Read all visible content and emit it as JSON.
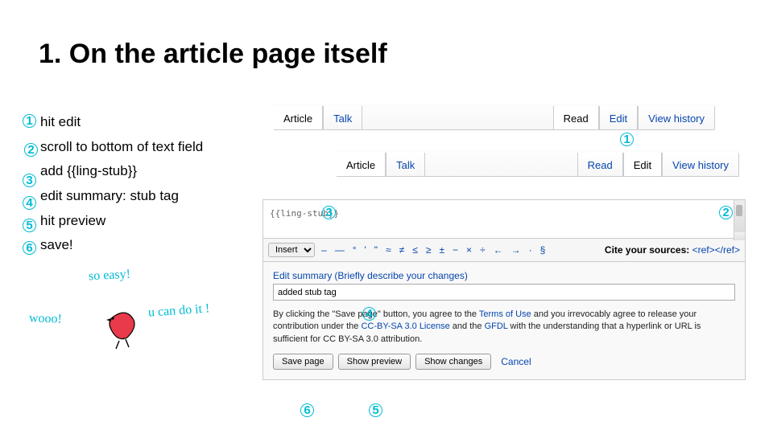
{
  "title": "1. On the article page itself",
  "steps": [
    "hit edit",
    "scroll to bottom of text field",
    "add {{ling-stub}}",
    "edit summary: stub tag",
    "hit preview",
    "save!"
  ],
  "tabs_top": {
    "article": "Article",
    "talk": "Talk",
    "read": "Read",
    "edit": "Edit",
    "history": "View history"
  },
  "tabs_mid": {
    "article": "Article",
    "talk": "Talk",
    "read": "Read",
    "edit": "Edit",
    "history": "View history"
  },
  "editor": {
    "textarea_value": "{{ling-stub}}",
    "insert_label": "Insert",
    "chars": [
      "–",
      "—",
      "°",
      "'",
      "\"",
      "≈",
      "≠",
      "≤",
      "≥",
      "±",
      "−",
      "×",
      "÷",
      "←",
      "→",
      "·",
      "§"
    ],
    "cite_label": "Cite your sources:",
    "reftag": "<ref></ref>",
    "summary_label": "Edit summary",
    "summary_hint": "(Briefly describe your changes)",
    "summary_value": "added stub tag",
    "legal_a": "By clicking the \"Save page\" button, you agree to the ",
    "legal_terms": "Terms of Use",
    "legal_b": " and you irrevocably agree to release your contribution under the ",
    "legal_cc": "CC-BY-SA 3.0 License",
    "legal_c": " and the ",
    "legal_gfdl": "GFDL",
    "legal_d": " with the understanding that a hyperlink or URL is sufficient for CC BY-SA 3.0 attribution.",
    "save": "Save page",
    "preview": "Show preview",
    "changes": "Show changes",
    "cancel": "Cancel"
  },
  "scribbles": {
    "soeasy": "so easy!",
    "wooo": "wooo!",
    "ucan": "u can do it !"
  }
}
